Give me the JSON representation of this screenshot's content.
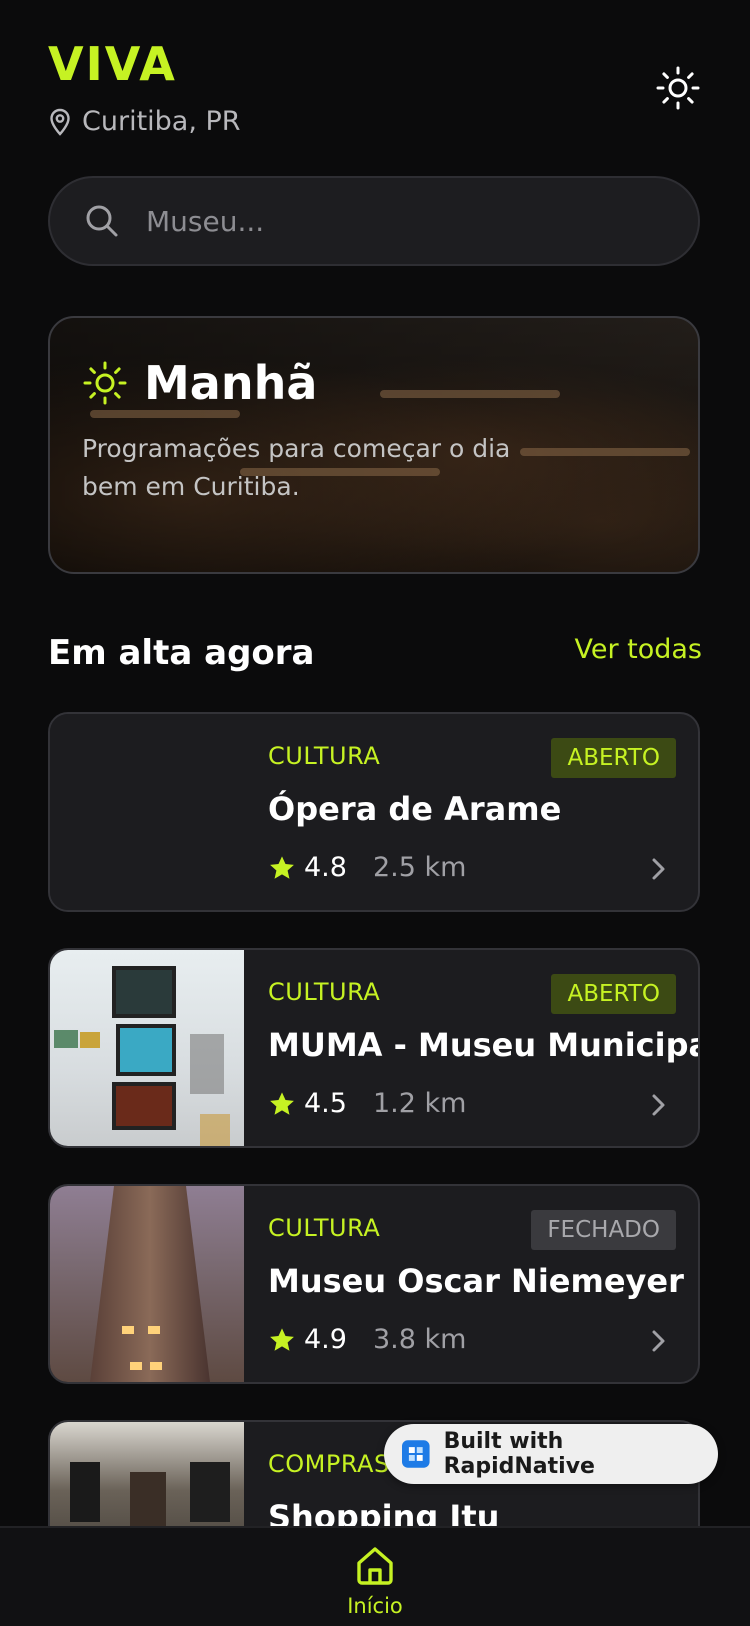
{
  "header": {
    "brand": "VIVA",
    "location": "Curitiba, PR"
  },
  "search": {
    "placeholder": "Museu..."
  },
  "hero": {
    "title": "Manhã",
    "subtitle": "Programações para começar o dia bem em Curitiba."
  },
  "section": {
    "title": "Em alta agora",
    "see_all": "Ver todas"
  },
  "places": [
    {
      "category": "CULTURA",
      "status": "ABERTO",
      "name": "Ópera de Arame",
      "rating": "4.8",
      "distance": "2.5 km"
    },
    {
      "category": "CULTURA",
      "status": "ABERTO",
      "name": "MUMA - Museu Municipal",
      "rating": "4.5",
      "distance": "1.2 km"
    },
    {
      "category": "CULTURA",
      "status": "FECHADO",
      "name": "Museu Oscar Niemeyer",
      "rating": "4.9",
      "distance": "3.8 km"
    },
    {
      "category": "COMPRAS",
      "name": "Shopping Itu"
    }
  ],
  "footer_badge": "Built with RapidNative",
  "tabbar": {
    "home_label": "Início"
  },
  "colors": {
    "accent": "#c6f223",
    "background": "#0b0b0c",
    "card": "#1c1c1f"
  },
  "icons": [
    "location-pin-icon",
    "sun-icon",
    "search-icon",
    "star-icon",
    "chevron-right-icon",
    "home-icon",
    "rapidnative-logo-icon"
  ]
}
